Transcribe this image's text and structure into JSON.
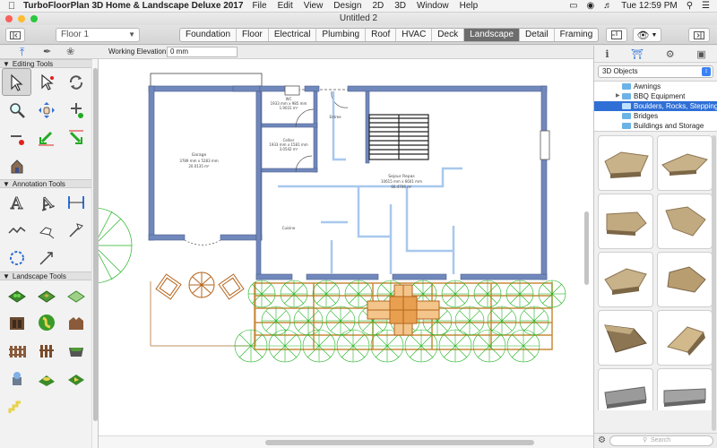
{
  "menubar": {
    "app_name": "TurboFloorPlan 3D Home & Landscape Deluxe 2017",
    "menus": [
      "File",
      "Edit",
      "View",
      "Design",
      "2D",
      "3D",
      "Window",
      "Help"
    ],
    "clock": "Tue 12:59 PM"
  },
  "window": {
    "title": "Untitled 2"
  },
  "toolbar": {
    "floor": "Floor 1",
    "tabs": [
      "Foundation",
      "Floor",
      "Electrical",
      "Plumbing",
      "Roof",
      "HVAC",
      "Deck",
      "Landscape",
      "Detail",
      "Framing"
    ],
    "active_tab": "Landscape"
  },
  "subbar": {
    "elevation_label": "Working Elevation:",
    "elevation_value": "0 mm"
  },
  "palette": {
    "sections": [
      "Editing Tools",
      "Annotation Tools",
      "Landscape Tools"
    ]
  },
  "plan": {
    "garage_name": "Garage",
    "garage_dims": "3789 mm x 5283 mm",
    "garage_area": "20.0135 m²",
    "wc_name": "WC",
    "wc_dims": "1933 mm x 985 mm",
    "wc_area": "1.9031 m²",
    "cellier_name": "Cellier",
    "cellier_dims": "1933 mm x 1581 mm",
    "cellier_area": "3.0542 m²",
    "entree": "Entree",
    "sejour_name": "Sejour Repas",
    "sejour_dims": "10615 mm x 6601 mm",
    "sejour_area": "66.4706 m²",
    "cuisine": "Cuisine"
  },
  "library": {
    "category": "3D Objects",
    "tree": [
      "Awnings",
      "BBQ Equipment",
      "Boulders, Rocks, Stepping Stones",
      "Bridges",
      "Buildings and Storage"
    ],
    "selected": "Boulders, Rocks, Stepping Stones",
    "search_placeholder": "Search"
  },
  "colors": {
    "wall": "#7088bb",
    "accent": "#2f6fd6",
    "plants": "#22b322",
    "deck": "#b5651d"
  }
}
